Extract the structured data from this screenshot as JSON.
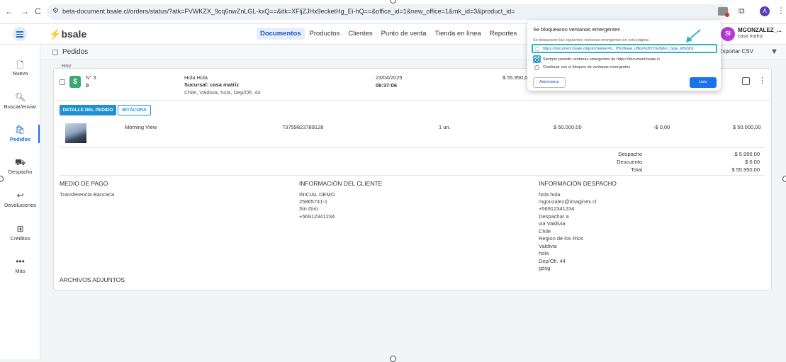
{
  "browser": {
    "back_icon": "←",
    "forward_icon": "→",
    "reload_icon": "C",
    "url": "beta-document.bsale.cl/orders/status/?atk=FVWKZX_9cq6nwZnLGL-kxQ==&itk=XFljZJHx9ecketHg_Ei-hQ==&office_id=1&new_office=1&mk_id=3&product_id=",
    "profile_initial": "A"
  },
  "header": {
    "logo_text": "bsale",
    "nav": [
      "Documentos",
      "Productos",
      "Clientes",
      "Punto de venta",
      "Tienda en línea",
      "Reportes"
    ],
    "active_nav": "Documentos",
    "user_initials": "SI",
    "user_name": "MGONZALEZ_...",
    "user_branch": "casa matriz"
  },
  "sidebar": {
    "items": [
      {
        "label": "Nuevo",
        "icon": "new-document-icon"
      },
      {
        "label": "Buscar/enviar",
        "icon": "search-document-icon"
      },
      {
        "label": "Pedidos",
        "icon": "orders-bag-icon"
      },
      {
        "label": "Despacho",
        "icon": "truck-icon"
      },
      {
        "label": "Devoluciones",
        "icon": "return-arrow-icon"
      },
      {
        "label": "Créditos",
        "icon": "credit-icon"
      },
      {
        "label": "Más",
        "icon": "more-dots-icon"
      }
    ],
    "active": "Pedidos"
  },
  "toolbar": {
    "title": "Pedidos",
    "export_label": "Exportar CSV"
  },
  "orders": {
    "day_label": "Hoy",
    "order": {
      "doc_number": "N° 3",
      "doc_zero": "0",
      "customer_name": "Hola Hola",
      "branch": "Sucursal: casa matriz",
      "address": "Chile, Valdivia, hola, Dep/Ofi. 44",
      "date": "23/04/2025",
      "time": "08:37:06",
      "total": "$ 55.950,00",
      "detail_button": "DETALLE DEL PEDIDO",
      "log_button": "BITÁCORA",
      "product": {
        "name": "Morning View",
        "sku": "73759823789128",
        "qty": "1 un.",
        "price": "$ 50.000,00",
        "discount": "-$ 0,00",
        "total": "$ 50.000,00"
      },
      "summary": [
        {
          "label": "Despacho",
          "value": "$ 5.950,00"
        },
        {
          "label": "Descuento",
          "value": "$ 0,00"
        },
        {
          "label": "Total",
          "value": "$ 55.950,00"
        }
      ],
      "payment": {
        "title": "MEDIO DE PAGO",
        "lines": [
          "Transferencia Bancaria"
        ]
      },
      "client": {
        "title": "INFORMACIÓN DEL CLIENTE",
        "lines": [
          "INICIAL DEMO",
          "25865741-1",
          "Sin Giro",
          "+56912341234"
        ]
      },
      "shipping": {
        "title": "INFORMACIÓN DESPACHO",
        "lines": [
          "hola hola",
          "mgonzalez@imaginex.cl",
          "+56912341234",
          "Despachar a",
          "via Valdivia",
          "Chile",
          "Region de los Rios",
          "Valdivia",
          "hola",
          "Dep/Ofi. 44",
          "gdsg"
        ]
      },
      "attachments_title": "ARCHIVOS ADJUNTOS"
    }
  },
  "popup_blocker": {
    "title": "Se bloquearon ventanas emergentes",
    "subtitle": "Se bloquearon las siguientes ventanas emergentes en esta página:",
    "blocked_url": "https://document.bsale.cl/goto?owner=b...7f%2fnew_office%3D1%26doc_type_id%3D1",
    "option_allow": "Siempre permitir ventanas emergentes de https://document.bsale.cl",
    "option_block": "Continuar con el bloqueo de ventanas emergentes",
    "manage_button": "Administrar",
    "done_button": "Listo",
    "highlight_color": "#2bb7c4"
  }
}
